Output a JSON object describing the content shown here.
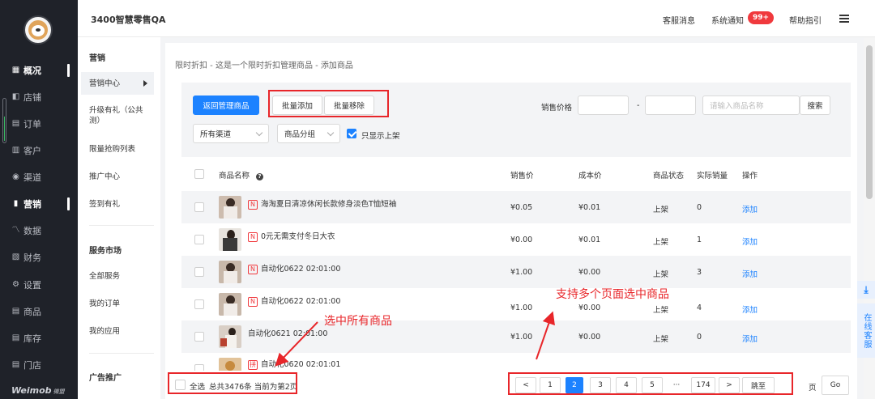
{
  "sidebar": {
    "brand": "Weimob",
    "brand_sub": "微盟",
    "items": [
      {
        "icon": "overview-icon",
        "glyph": "▦",
        "label": "概况",
        "active": true
      },
      {
        "icon": "store-icon",
        "glyph": "◧",
        "label": "店铺",
        "active": false
      },
      {
        "icon": "order-icon",
        "glyph": "▤",
        "label": "订单",
        "active": false
      },
      {
        "icon": "customer-icon",
        "glyph": "▥",
        "label": "客户",
        "active": false
      },
      {
        "icon": "channel-icon",
        "glyph": "◉",
        "label": "渠道",
        "active": false
      },
      {
        "icon": "marketing-icon",
        "glyph": "▮",
        "label": "营销",
        "active": true
      },
      {
        "icon": "data-icon",
        "glyph": "〽",
        "label": "数据",
        "active": false
      },
      {
        "icon": "finance-icon",
        "glyph": "▧",
        "label": "财务",
        "active": false
      },
      {
        "icon": "settings-icon",
        "glyph": "⚙",
        "label": "设置",
        "active": false
      },
      {
        "icon": "goods-icon",
        "glyph": "▤",
        "label": "商品",
        "active": false
      },
      {
        "icon": "inventory-icon",
        "glyph": "▤",
        "label": "库存",
        "active": false
      },
      {
        "icon": "shop-icon",
        "glyph": "▤",
        "label": "门店",
        "active": false
      }
    ]
  },
  "topbar": {
    "store_name": "3400智慧零售QA",
    "service_msg": "客服消息",
    "system_notice": "系统通知",
    "notice_badge": "99+",
    "help": "帮助指引"
  },
  "subnav": {
    "section_marketing": "营销",
    "marketing_center": "营销中心",
    "items": [
      "升级有礼（公共测）",
      "限量抢购列表",
      "推广中心",
      "签到有礼"
    ],
    "section_service": "服务市场",
    "service_items": [
      "全部服务",
      "我的订单",
      "我的应用"
    ],
    "section_ad": "广告推广"
  },
  "breadcrumb": "限时折扣 - 这是一个限时折扣管理商品 - 添加商品",
  "toolbar": {
    "back_btn": "返回管理商品",
    "batch_add": "批量添加",
    "batch_remove": "批量移除",
    "price_label": "销售价格",
    "price_min": "",
    "price_sep": "-",
    "price_max": "",
    "search_placeholder": "请输入商品名称",
    "search_btn": "搜索",
    "channel_select": "所有渠道",
    "group_select": "商品分组",
    "only_onshelf": "只显示上架",
    "only_onshelf_checked": true
  },
  "table": {
    "headers": {
      "name": "商品名称",
      "price": "销售价",
      "cost": "成本价",
      "status": "商品状态",
      "sales": "实际销量",
      "action": "操作"
    },
    "rows": [
      {
        "tag": "N",
        "tag_type": "n",
        "name": "海淘夏日清凉休闲长款修身淡色T恤短袖",
        "price": "¥0.05",
        "cost": "¥0.01",
        "status": "上架",
        "sales": "0",
        "action": "添加",
        "checked": false
      },
      {
        "tag": "N",
        "tag_type": "n",
        "name": "0元无需支付冬日大衣",
        "price": "¥0.00",
        "cost": "¥0.01",
        "status": "上架",
        "sales": "1",
        "action": "添加",
        "checked": false
      },
      {
        "tag": "N",
        "tag_type": "n",
        "name": "自动化0622 02:01:00",
        "price": "¥1.00",
        "cost": "¥0.00",
        "status": "上架",
        "sales": "3",
        "action": "添加",
        "checked": false
      },
      {
        "tag": "N",
        "tag_type": "n",
        "name": "自动化0622 02:01:00",
        "price": "¥1.00",
        "cost": "¥0.00",
        "status": "上架",
        "sales": "4",
        "action": "添加",
        "checked": false
      },
      {
        "tag": "",
        "tag_type": "",
        "name": "自动化0621 02:01:00",
        "price": "¥1.00",
        "cost": "¥0.00",
        "status": "上架",
        "sales": "0",
        "action": "添加",
        "checked": false
      },
      {
        "tag": "拼",
        "tag_type": "pin",
        "name": "自动化0620 02:01:01",
        "price": "",
        "cost": "",
        "status": "",
        "sales": "",
        "action": "",
        "checked": false
      }
    ]
  },
  "footer": {
    "select_all": "全选",
    "total_text": "总共3476条 当前为第2页",
    "pages": [
      "1",
      "2",
      "3",
      "4",
      "5",
      "···",
      "174"
    ],
    "current_page": "2",
    "prev": "<",
    "next": ">",
    "jump_label": "跳至",
    "page_unit": "页",
    "go_btn": "Go"
  },
  "annotations": {
    "select_all_note": "选中所有商品",
    "multi_page_note": "支持多个页面选中商品"
  },
  "float": {
    "down": "⤓",
    "online_service": "在线客服"
  },
  "colors": {
    "accent": "#1c82ff",
    "annotation_red": "#e8262a",
    "sidebar_bg": "#1f2229"
  }
}
